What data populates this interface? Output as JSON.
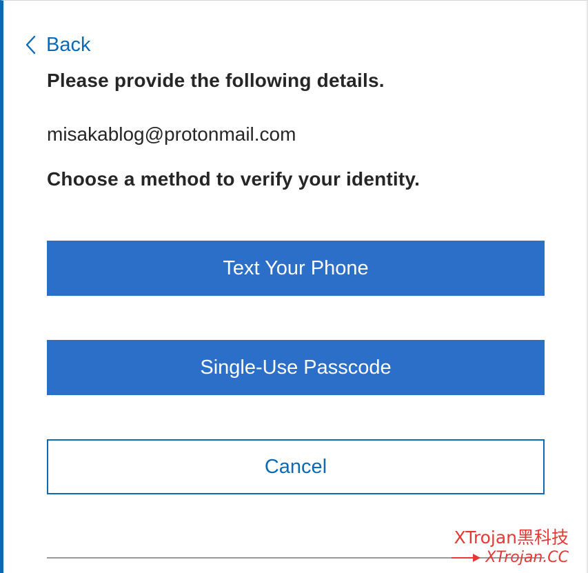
{
  "nav": {
    "back_label": "Back",
    "back_icon": "chevron-left-icon"
  },
  "form": {
    "heading": "Please provide the following details.",
    "email": "misakablog@protonmail.com",
    "subheading": "Choose a method to verify your identity."
  },
  "actions": {
    "text_phone_label": "Text Your Phone",
    "passcode_label": "Single-Use Passcode",
    "cancel_label": "Cancel"
  },
  "watermark": {
    "line1": "XTrojan黑科技",
    "line2": "XTrojan.CC",
    "arrow_icon": "arrow-right-icon"
  },
  "colors": {
    "accent": "#0b6ab3",
    "primary_button": "#2b6fc8",
    "text": "#262626",
    "watermark": "#e53935"
  }
}
